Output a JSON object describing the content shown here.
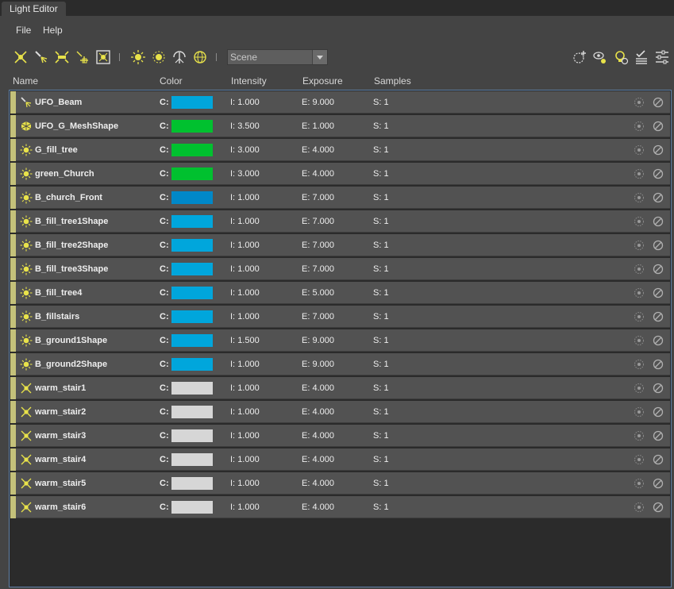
{
  "window": {
    "tab_title": "Light Editor"
  },
  "menu": {
    "file": "File",
    "help": "Help"
  },
  "toolbar": {
    "left_icons": [
      "directional-light-icon",
      "spot-light-icon",
      "area-light-icon",
      "volume-light-icon",
      "render-light-icon",
      "point-light-icon",
      "ambient-light-icon",
      "sky-light-icon",
      "environment-light-icon"
    ],
    "right_icons": [
      "add-light-icon",
      "look-through-icon",
      "bulb-icon",
      "filter-icon",
      "settings-list-icon"
    ],
    "scope_dropdown": {
      "value": "Scene"
    }
  },
  "columns": {
    "name": "Name",
    "color": "Color",
    "intensity": "Intensity",
    "exposure": "Exposure",
    "samples": "Samples"
  },
  "prefixes": {
    "color": "C:",
    "intensity": "I:",
    "exposure": "E:",
    "samples": "S:"
  },
  "lights": [
    {
      "name": "UFO_Beam",
      "type": "spot",
      "color": "#00a6dc",
      "intensity": "1.000",
      "exposure": "9.000",
      "samples": "1"
    },
    {
      "name": "UFO_G_MeshShape",
      "type": "mesh",
      "color": "#00c12f",
      "intensity": "3.500",
      "exposure": "1.000",
      "samples": "1"
    },
    {
      "name": "G_fill_tree",
      "type": "point",
      "color": "#00c12f",
      "intensity": "3.000",
      "exposure": "4.000",
      "samples": "1"
    },
    {
      "name": "green_Church",
      "type": "point",
      "color": "#00c12f",
      "intensity": "3.000",
      "exposure": "4.000",
      "samples": "1"
    },
    {
      "name": "B_church_Front",
      "type": "point",
      "color": "#0088c8",
      "intensity": "1.000",
      "exposure": "7.000",
      "samples": "1"
    },
    {
      "name": "B_fill_tree1Shape",
      "type": "point",
      "color": "#00a6dc",
      "intensity": "1.000",
      "exposure": "7.000",
      "samples": "1"
    },
    {
      "name": "B_fill_tree2Shape",
      "type": "point",
      "color": "#00a6dc",
      "intensity": "1.000",
      "exposure": "7.000",
      "samples": "1"
    },
    {
      "name": "B_fill_tree3Shape",
      "type": "point",
      "color": "#00a6dc",
      "intensity": "1.000",
      "exposure": "7.000",
      "samples": "1"
    },
    {
      "name": "B_fill_tree4",
      "type": "point",
      "color": "#00a6dc",
      "intensity": "1.000",
      "exposure": "5.000",
      "samples": "1"
    },
    {
      "name": "B_fillstairs",
      "type": "point",
      "color": "#00a6dc",
      "intensity": "1.000",
      "exposure": "7.000",
      "samples": "1"
    },
    {
      "name": "B_ground1Shape",
      "type": "point",
      "color": "#00a6dc",
      "intensity": "1.500",
      "exposure": "9.000",
      "samples": "1"
    },
    {
      "name": "B_ground2Shape",
      "type": "point",
      "color": "#00a6dc",
      "intensity": "1.000",
      "exposure": "9.000",
      "samples": "1"
    },
    {
      "name": "warm_stair1",
      "type": "directional",
      "color": "#d6d6d6",
      "intensity": "1.000",
      "exposure": "4.000",
      "samples": "1"
    },
    {
      "name": "warm_stair2",
      "type": "directional",
      "color": "#d6d6d6",
      "intensity": "1.000",
      "exposure": "4.000",
      "samples": "1"
    },
    {
      "name": "warm_stair3",
      "type": "directional",
      "color": "#d6d6d6",
      "intensity": "1.000",
      "exposure": "4.000",
      "samples": "1"
    },
    {
      "name": "warm_stair4",
      "type": "directional",
      "color": "#d6d6d6",
      "intensity": "1.000",
      "exposure": "4.000",
      "samples": "1"
    },
    {
      "name": "warm_stair5",
      "type": "directional",
      "color": "#d6d6d6",
      "intensity": "1.000",
      "exposure": "4.000",
      "samples": "1"
    },
    {
      "name": "warm_stair6",
      "type": "directional",
      "color": "#d6d6d6",
      "intensity": "1.000",
      "exposure": "4.000",
      "samples": "1"
    }
  ]
}
